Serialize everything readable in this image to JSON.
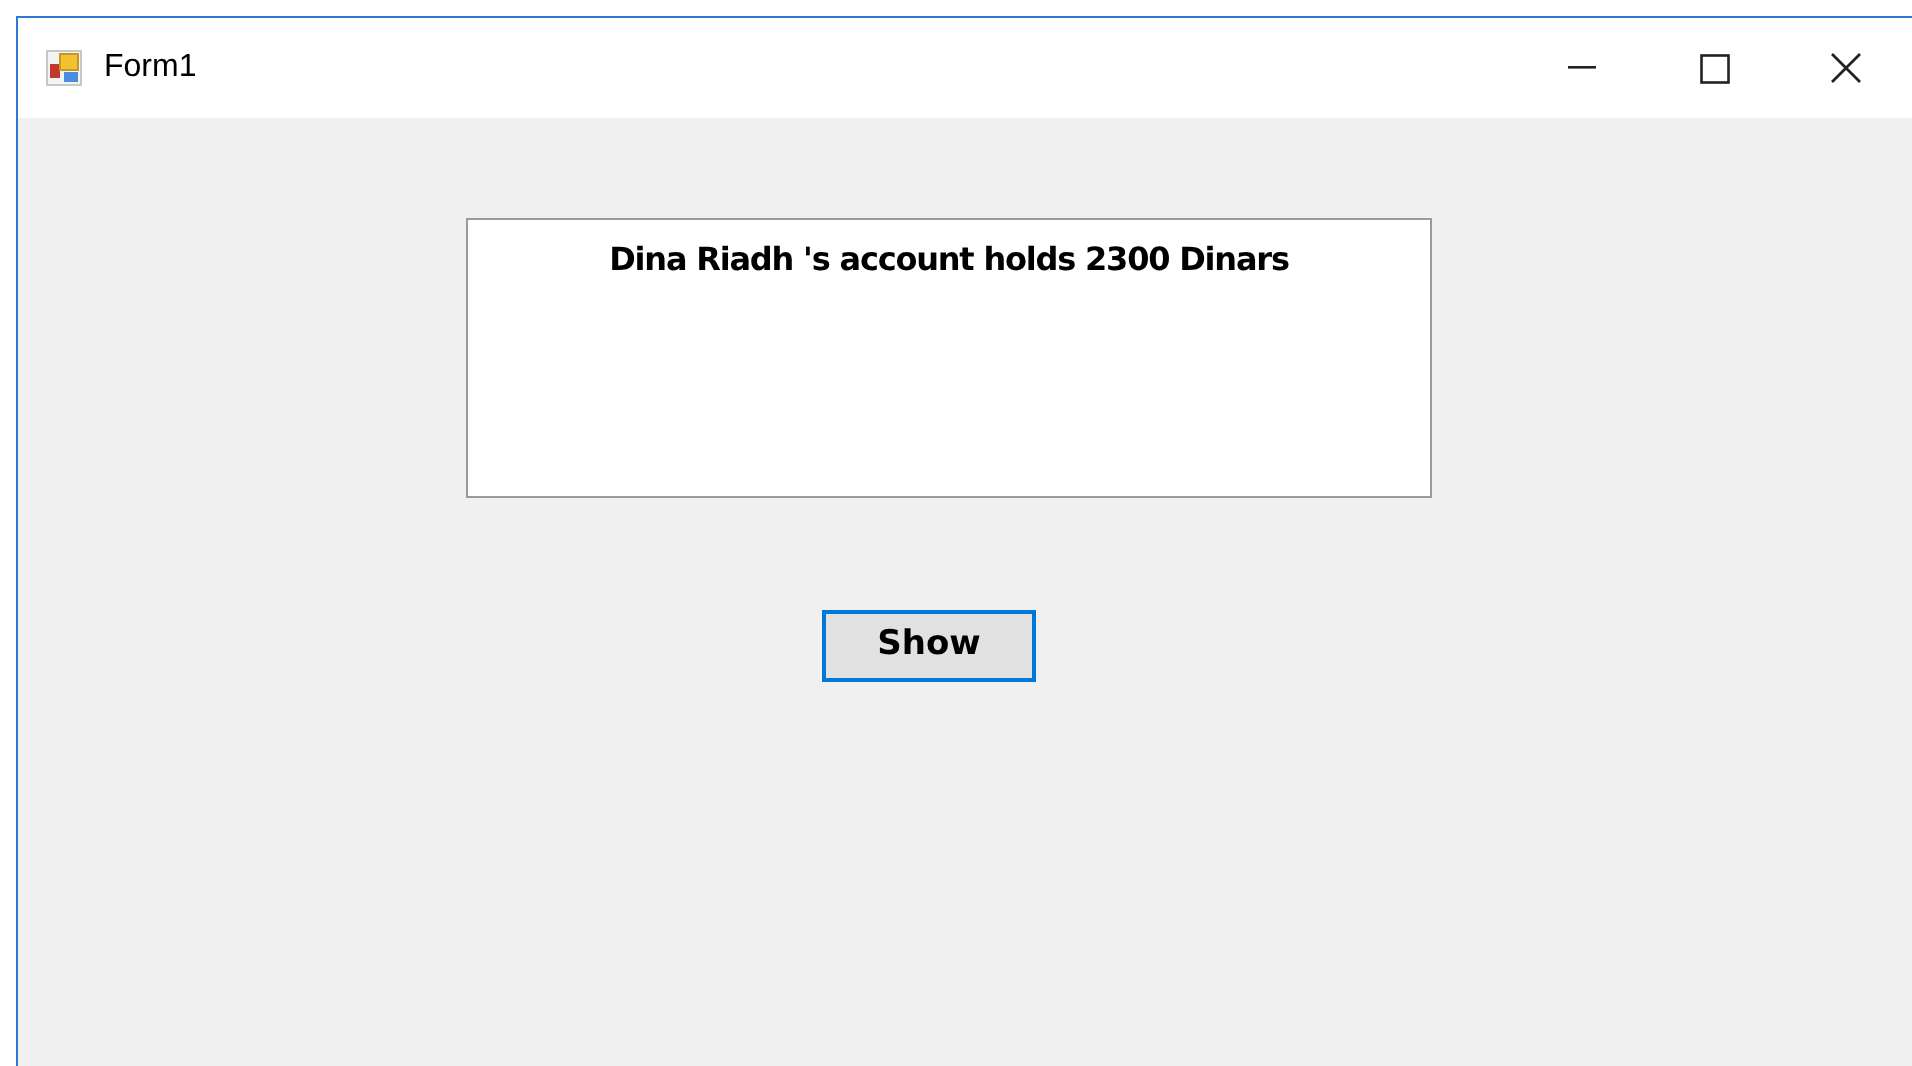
{
  "window": {
    "title": "Form1"
  },
  "label": {
    "text": "Dina Riadh 's account holds 2300 Dinars"
  },
  "button": {
    "label": "Show",
    "focused": true
  }
}
